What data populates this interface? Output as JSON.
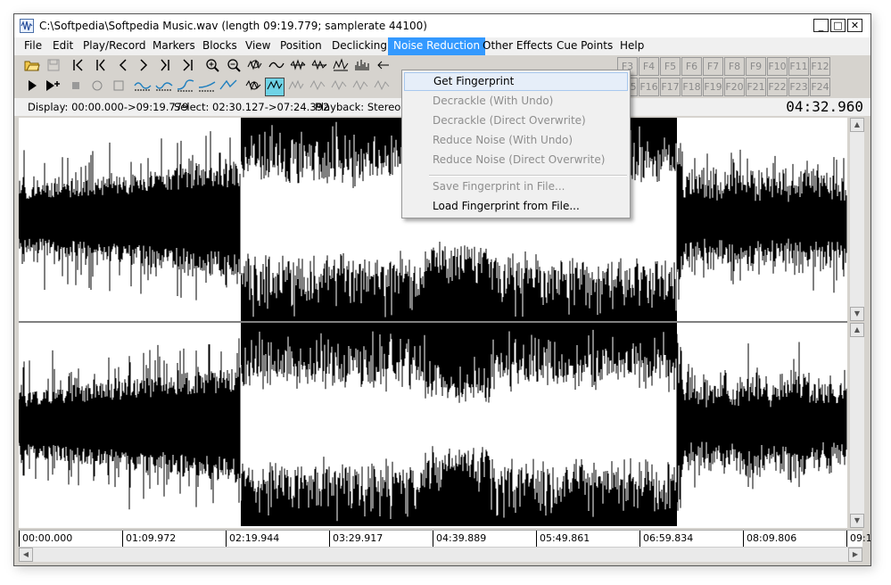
{
  "window": {
    "title": "C:\\Softpedia\\Softpedia Music.wav (length 09:19.779; samplerate 44100)",
    "minimize_label": "_",
    "maximize_label": "□",
    "close_label": "✕"
  },
  "menubar": {
    "items": [
      {
        "label": "File"
      },
      {
        "label": "Edit"
      },
      {
        "label": "Play/Record"
      },
      {
        "label": "Markers"
      },
      {
        "label": "Blocks"
      },
      {
        "label": "View"
      },
      {
        "label": "Position"
      },
      {
        "label": "Declicking"
      },
      {
        "label": "Noise Reduction",
        "active": true
      },
      {
        "label": "Other Effects"
      },
      {
        "label": "Cue Points"
      },
      {
        "label": "Help"
      }
    ]
  },
  "dropdown": {
    "items": [
      {
        "label": "Get Fingerprint",
        "enabled": true,
        "highlighted": true
      },
      {
        "label": "Decrackle (With Undo)",
        "enabled": false
      },
      {
        "label": "Decrackle (Direct Overwrite)",
        "enabled": false
      },
      {
        "label": "Reduce Noise (With Undo)",
        "enabled": false
      },
      {
        "label": "Reduce Noise (Direct Overwrite)",
        "enabled": false
      },
      {
        "label": "Save Fingerprint in File...",
        "enabled": false
      },
      {
        "label": "Load Fingerprint from File...",
        "enabled": true
      }
    ]
  },
  "toolbar": {
    "row1_icons": [
      "open-folder-icon",
      "save-icon",
      "go-start-icon",
      "prev-marker-icon",
      "step-back-icon",
      "step-forward-icon",
      "next-marker-icon",
      "go-end-icon",
      "zoom-in-icon",
      "zoom-out-icon",
      "zoom-fit-icon",
      "wave-view-icon",
      "wave-markers-icon",
      "wave-cut-icon",
      "wave-select-icon",
      "wave-spectrum-icon",
      "move-left-icon"
    ],
    "row2_icons": [
      "play-icon",
      "play-from-icon",
      "stop-icon",
      "record-icon",
      "loop-icon",
      "fade-in-icon",
      "fade-out-icon",
      "crossfade-icon",
      "amplify-icon",
      "normalize-icon",
      "declick-icon",
      "filter-active-icon",
      "filter-icon",
      "effect-icon",
      "effect2-icon",
      "effect3-icon",
      "effect4-icon"
    ],
    "fkeys_row1": [
      "F3",
      "F4",
      "F5",
      "F6",
      "F7",
      "F8",
      "F9",
      "F10",
      "F11",
      "F12"
    ],
    "fkeys_row2": [
      "F15",
      "F16",
      "F17",
      "F18",
      "F19",
      "F20",
      "F21",
      "F22",
      "F23",
      "F24"
    ]
  },
  "status": {
    "display": "Display: 00:00.000->09:19.779",
    "select": "Select: 02:30.127->07:24.392",
    "playback": "Playback: Stereo",
    "current_time": "04:32.960"
  },
  "timeline": {
    "ticks": [
      "00:00.000",
      "01:09.972",
      "02:19.944",
      "03:29.917",
      "04:39.889",
      "05:49.861",
      "06:59.834",
      "08:09.806",
      "09:1"
    ]
  },
  "waveform": {
    "selection_start": 0.2677,
    "selection_end": 0.7944,
    "wave_color": "#000000",
    "background": "#ffffff"
  }
}
